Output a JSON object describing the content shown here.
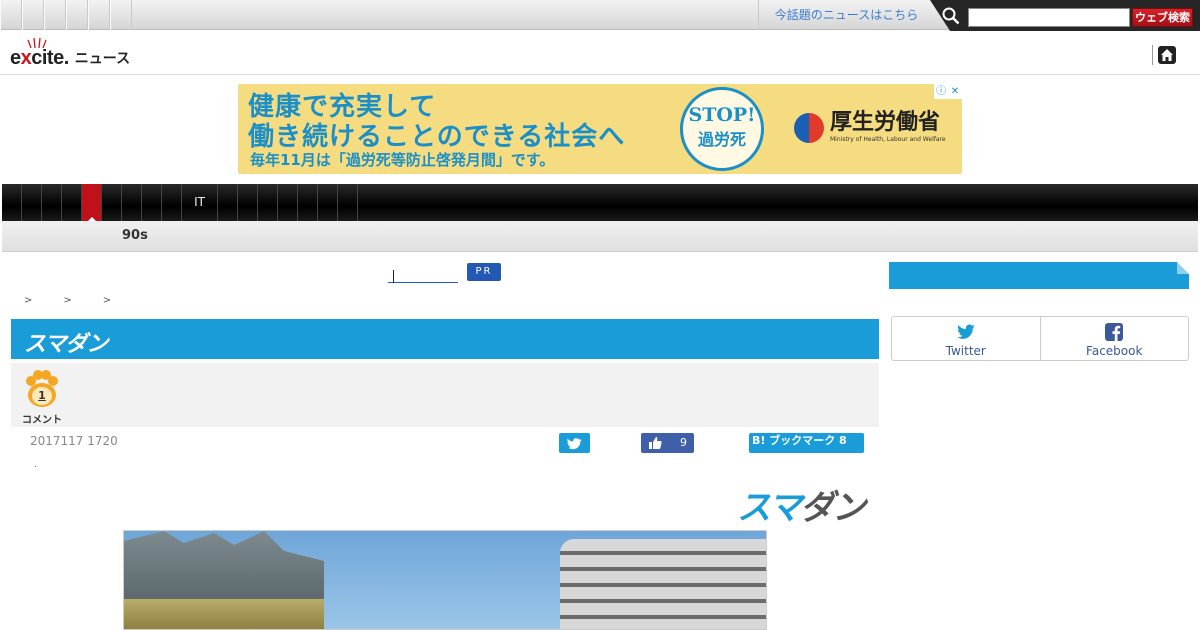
{
  "topbar": {
    "trend_link": "今話題のニュースはこちら",
    "search_placeholder": "",
    "search_button": "ウェブ検索",
    "search_icon": "magnifier-icon"
  },
  "header": {
    "logo_text": "excite",
    "section_label": "ニュース",
    "home_icon": "home-icon"
  },
  "ad": {
    "line1": "健康で充実して",
    "line2": "働き続けることのできる社会へ",
    "line3": "毎年11月は「過労死等防止啓発月間」です。",
    "badge_line1": "STOP!",
    "badge_line2": "過労死",
    "ministry_name": "厚生労働省",
    "ministry_en": "Ministry of Health, Labour and Welfare",
    "info_icon": "ⓘ",
    "close_icon": "✕"
  },
  "catnav": {
    "items": [
      "",
      "",
      "",
      "",
      "",
      "",
      "",
      "",
      "",
      "IT",
      "",
      "",
      "",
      "",
      "",
      "",
      ""
    ],
    "active_index": 4
  },
  "subnav": {
    "tag": "90s"
  },
  "article": {
    "pr_badge": "PR",
    "breadcrumb": [
      ">",
      ">",
      ">"
    ],
    "media_logo": "スマダン",
    "comment_count": "1",
    "comment_label": "コメント",
    "date": "2017117 1720",
    "dot": ".",
    "like_count": "9",
    "hatena_label": "B! ブックマーク 8",
    "logo_part1": "スマ",
    "logo_part2": "ダン"
  },
  "sidebar": {
    "sns": [
      {
        "label": "Twitter",
        "icon": "twitter-icon"
      },
      {
        "label": "Facebook",
        "icon": "facebook-icon"
      }
    ]
  },
  "colors": {
    "accent_blue": "#1a9cd8",
    "active_red": "#c0101a",
    "search_red": "#d6232a",
    "ad_yellow": "#f6dc80"
  }
}
